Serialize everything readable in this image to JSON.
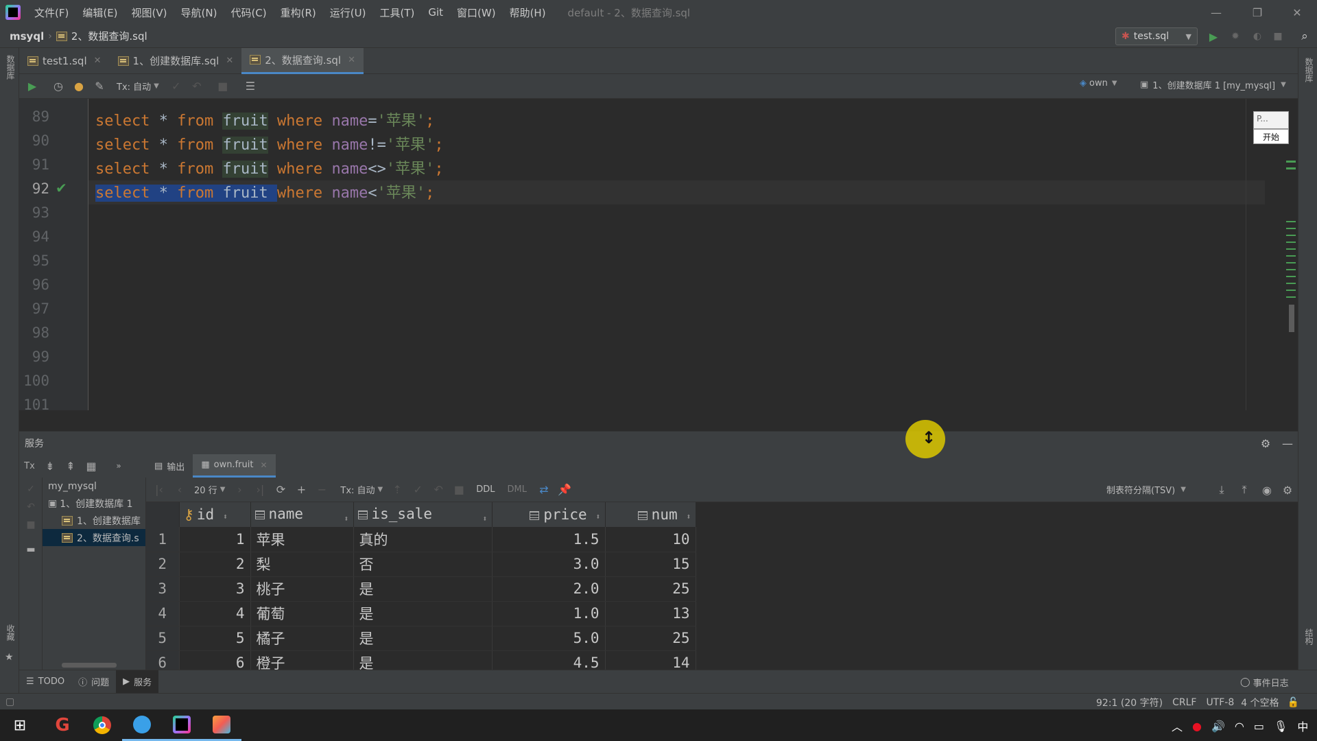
{
  "menu": {
    "items": [
      "文件(F)",
      "编辑(E)",
      "视图(V)",
      "导航(N)",
      "代码(C)",
      "重构(R)",
      "运行(U)",
      "工具(T)",
      "Git",
      "窗口(W)",
      "帮助(H)"
    ],
    "window_title": "default - 2、数据查询.sql"
  },
  "nav": {
    "project": "msyql",
    "file": "2、数据查询.sql",
    "run_config": "test.sql"
  },
  "tabs": [
    {
      "label": "test1.sql",
      "active": false
    },
    {
      "label": "1、创建数据库.sql",
      "active": false
    },
    {
      "label": "2、数据查询.sql",
      "active": true
    }
  ],
  "toolbar": {
    "tx_mode": "Tx: 自动",
    "schema": "own",
    "session": "1、创建数据库 1 [my_mysql]"
  },
  "editor": {
    "line_numbers": [
      "89",
      "90",
      "91",
      "92",
      "93",
      "94",
      "95",
      "96",
      "97",
      "98",
      "99",
      "100",
      "101"
    ],
    "current_line": "92",
    "lines": [
      {
        "kw1": "select",
        "star": "*",
        "kw2": "from",
        "table": "fruit",
        "kw3": "where",
        "col": "name",
        "op": "=",
        "str": "'苹果'",
        "end": ";"
      },
      {
        "kw1": "select",
        "star": "*",
        "kw2": "from",
        "table": "fruit",
        "kw3": "where",
        "col": "name",
        "op": "!=",
        "str": "'苹果'",
        "end": ";"
      },
      {
        "kw1": "select",
        "star": "*",
        "kw2": "from",
        "table": "fruit",
        "kw3": "where",
        "col": "name",
        "op": "<>",
        "str": "'苹果'",
        "end": ";"
      },
      {
        "kw1": "select",
        "star": "*",
        "kw2": "from",
        "table": "fruit",
        "kw3": "where",
        "col": "name",
        "op": "<",
        "str": "'苹果'",
        "end": ";"
      }
    ],
    "minipopup": {
      "label": "P...",
      "button": "开始"
    }
  },
  "services": {
    "title": "服务",
    "tree": [
      {
        "label": "my_mysql",
        "level": 0
      },
      {
        "label": "1、创建数据库 1",
        "level": 1
      },
      {
        "label": "1、创建数据库",
        "level": 2
      },
      {
        "label": "2、数据查询.s",
        "level": 2
      }
    ],
    "tabs": [
      {
        "label": "输出"
      },
      {
        "label": "own.fruit"
      }
    ],
    "rows_per_page": "20 行",
    "tx_mode": "Tx: 自动",
    "ddl": "DDL",
    "dml": "DML",
    "export_format": "制表符分隔(TSV)"
  },
  "grid": {
    "columns": [
      "id",
      "name",
      "is_sale",
      "price",
      "num"
    ],
    "rows": [
      {
        "rn": "1",
        "id": "1",
        "name": "苹果",
        "is_sale": "真的",
        "price": "1.5",
        "num": "10"
      },
      {
        "rn": "2",
        "id": "2",
        "name": "梨",
        "is_sale": "否",
        "price": "3.0",
        "num": "15"
      },
      {
        "rn": "3",
        "id": "3",
        "name": "桃子",
        "is_sale": "是",
        "price": "2.0",
        "num": "25"
      },
      {
        "rn": "4",
        "id": "4",
        "name": "葡萄",
        "is_sale": "是",
        "price": "1.0",
        "num": "13"
      },
      {
        "rn": "5",
        "id": "5",
        "name": "橘子",
        "is_sale": "是",
        "price": "5.0",
        "num": "25"
      },
      {
        "rn": "6",
        "id": "6",
        "name": "橙子",
        "is_sale": "是",
        "price": "4.5",
        "num": "14"
      }
    ]
  },
  "bottom_tools": {
    "todo": "TODO",
    "problems": "问题",
    "services": "服务",
    "event_log": "事件日志"
  },
  "status": {
    "position": "92:1 (20 字符)",
    "line_sep": "CRLF",
    "encoding": "UTF-8",
    "indent": "4 个空格"
  },
  "stripes": {
    "left_top": "数据库",
    "left_bottom": "收藏",
    "right_top": "数据库",
    "right_bottom": "结构"
  },
  "taskbar": {
    "ime": "中"
  },
  "colors": {
    "keyword": "#cc7832",
    "string": "#6a8759",
    "column": "#9876aa",
    "selection": "#214283",
    "accent": "#4a88c7",
    "run_green": "#499c54"
  }
}
